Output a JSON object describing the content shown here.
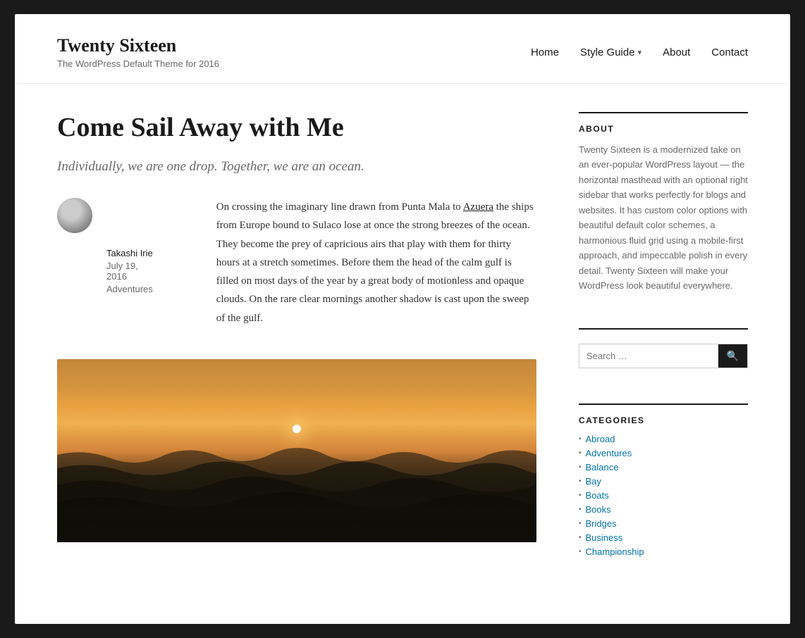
{
  "site": {
    "title": "Twenty Sixteen",
    "description": "The WordPress Default Theme for 2016"
  },
  "nav": {
    "items": [
      {
        "label": "Home",
        "has_dropdown": false
      },
      {
        "label": "Style Guide",
        "has_dropdown": true
      },
      {
        "label": "About",
        "has_dropdown": false
      },
      {
        "label": "Contact",
        "has_dropdown": false
      }
    ]
  },
  "post": {
    "title": "Come Sail Away with Me",
    "subtitle": "Individually, we are one drop. Together, we are an ocean.",
    "author": "Takashi Irie",
    "date": "July 19, 2016",
    "category": "Adventures",
    "content": "On crossing the imaginary line drawn from Punta Mala to Azuera the ships from Europe bound to Sulaco lose at once the strong breezes of the ocean. They become the prey of capricious airs that play with them for thirty hours at a stretch sometimes. Before them the head of the calm gulf is filled on most days of the year by a great body of motionless and opaque clouds. On the rare clear mornings another shadow is cast upon the sweep of the gulf.",
    "link_text": "Azuera"
  },
  "sidebar": {
    "about": {
      "title": "ABOUT",
      "text": "Twenty Sixteen is a modernized take on an ever-popular WordPress layout — the horizontal masthead with an optional right sidebar that works perfectly for blogs and websites. It has custom color options with beautiful default color schemes, a harmonious fluid grid using a mobile-first approach, and impeccable polish in every detail. Twenty Sixteen will make your WordPress look beautiful everywhere."
    },
    "search": {
      "placeholder": "Search …"
    },
    "categories": {
      "title": "CATEGORIES",
      "items": [
        "Abroad",
        "Adventures",
        "Balance",
        "Bay",
        "Boats",
        "Books",
        "Bridges",
        "Business",
        "Championship"
      ]
    }
  }
}
